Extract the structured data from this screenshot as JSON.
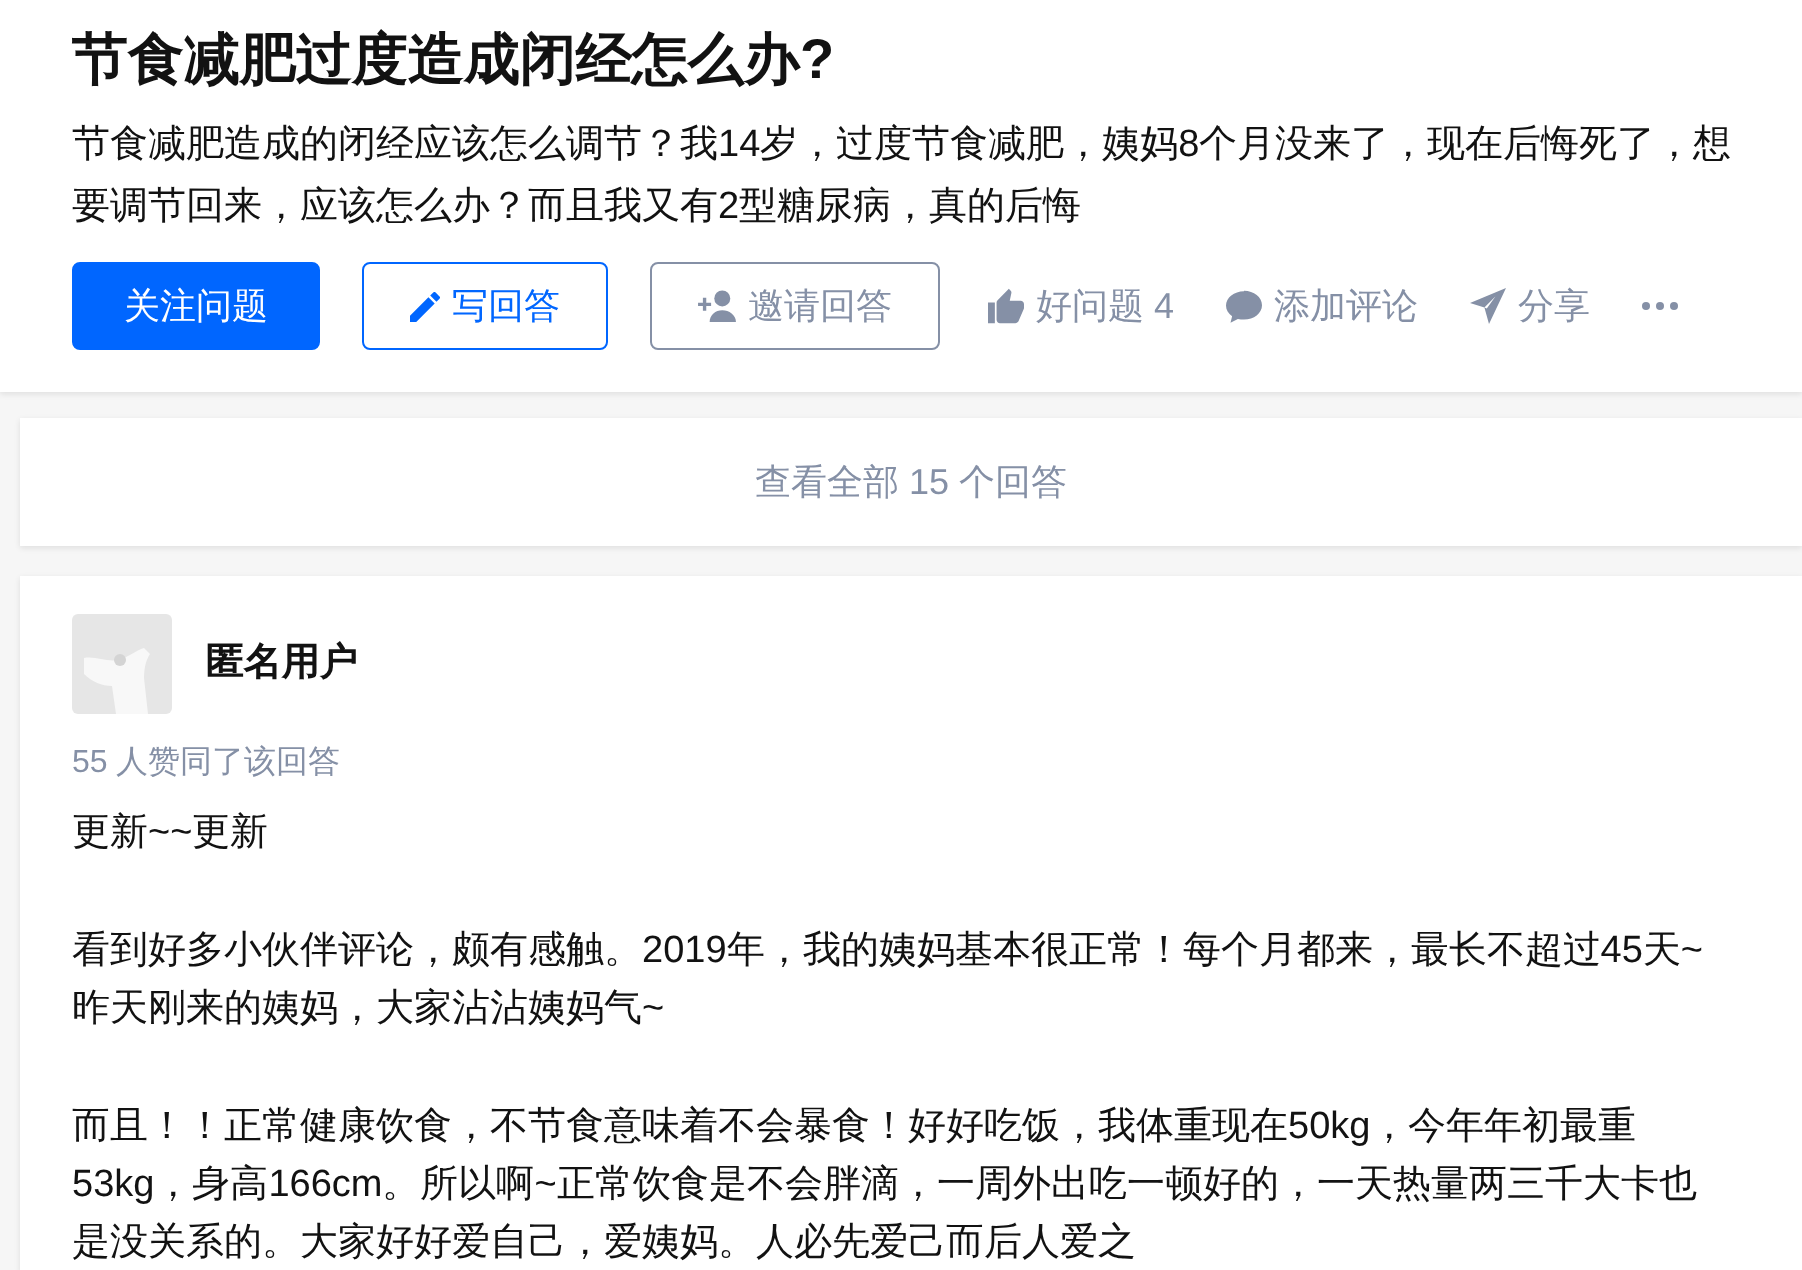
{
  "question": {
    "title": "节食减肥过度造成闭经怎么办?",
    "detail": "节食减肥造成的闭经应该怎么调节？我14岁，过度节食减肥，姨妈8个月没来了，现在后悔死了，想要调节回来，应该怎么办？而且我又有2型糖尿病，真的后悔"
  },
  "buttons": [
    {
      "kind": "follow",
      "label": "关注问题"
    },
    {
      "kind": "write",
      "label": "写回答"
    },
    {
      "kind": "invite",
      "label": "邀请回答"
    }
  ],
  "links": [
    {
      "kind": "like",
      "label": "好问题 4"
    },
    {
      "kind": "comment",
      "label": "添加评论"
    },
    {
      "kind": "share",
      "label": "分享"
    },
    {
      "kind": "more"
    }
  ],
  "view_all": "查看全部 15 个回答",
  "answer": {
    "author": "匿名用户",
    "votes": "55 人赞同了该回答",
    "paragraphs": [
      "更新~~更新",
      "看到好多小伙伴评论，颇有感触。2019年，我的姨妈基本很正常！每个月都来，最长不超过45天~昨天刚来的姨妈，大家沾沾姨妈气~",
      "而且！！正常健康饮食，不节食意味着不会暴食！好好吃饭，我体重现在50kg，今年年初最重53kg，身高166cm。所以啊~正常饮食是不会胖滴，一周外出吃一顿好的，一天热量两三千大卡也是没关系的。大家好好爱自己，爱姨妈。人必先爱己而后人爱之"
    ]
  }
}
